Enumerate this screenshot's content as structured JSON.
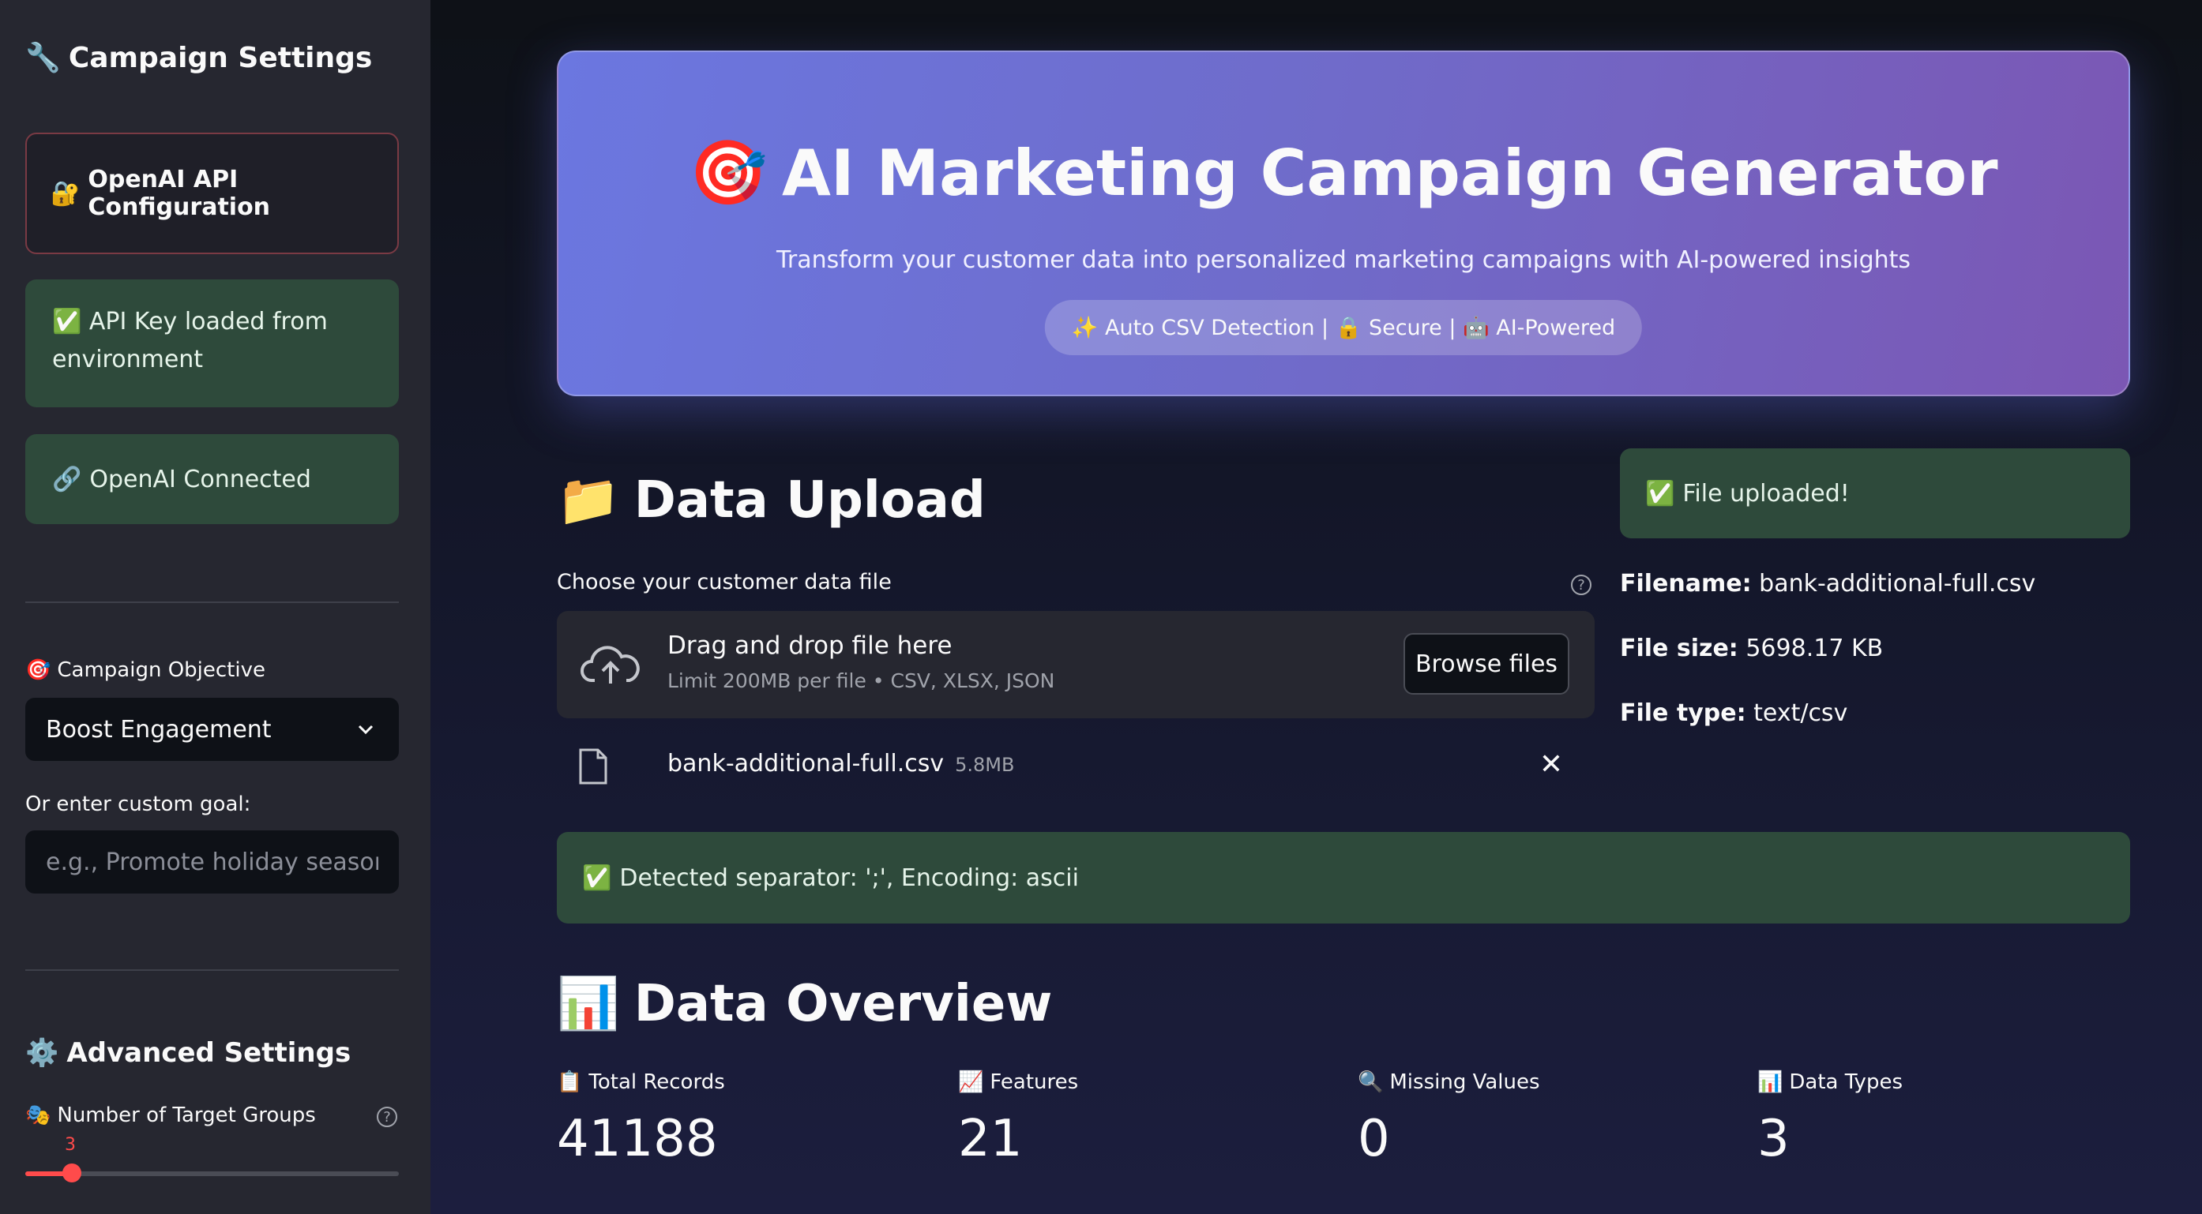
{
  "sidebar": {
    "title": "Campaign Settings",
    "api_config": "OpenAI API Configuration",
    "api_key_status": "API Key loaded from environment",
    "connection_status": "OpenAI Connected",
    "objective_label": "Campaign Objective",
    "objective_value": "Boost Engagement",
    "custom_goal_label": "Or enter custom goal:",
    "custom_goal_placeholder": "e.g., Promote holiday season offers",
    "advanced_title": "Advanced Settings",
    "target_groups_label": "Number of Target Groups",
    "target_groups_value": 3,
    "target_groups_min": 2,
    "target_groups_max": 10,
    "icons": {
      "title": "wrench-icon",
      "api_config": "lock-key-icon",
      "api_key_status": "check-icon",
      "connection_status": "link-icon",
      "objective": "target-icon",
      "advanced": "gear-icon",
      "target_groups": "mask-icon"
    }
  },
  "hero": {
    "title": "AI Marketing Campaign Generator",
    "subtitle": "Transform your customer data into personalized marketing campaigns with AI-powered insights",
    "badge": "✨ Auto CSV Detection | 🔒 Secure | 🤖 AI-Powered"
  },
  "upload": {
    "heading": "Data Upload",
    "label": "Choose your customer data file",
    "drop_title": "Drag and drop file here",
    "drop_limit": "Limit 200MB per file • CSV, XLSX, JSON",
    "browse_label": "Browse files",
    "file_name": "bank-additional-full.csv",
    "file_size": "5.8MB",
    "detected": "Detected separator: ';', Encoding: ascii"
  },
  "file_info": {
    "status": "File uploaded!",
    "filename_label": "Filename:",
    "filename_value": "bank-additional-full.csv",
    "size_label": "File size:",
    "size_value": "5698.17 KB",
    "type_label": "File type:",
    "type_value": "text/csv"
  },
  "overview": {
    "heading": "Data Overview",
    "metrics": [
      {
        "label": "Total Records",
        "value": "41188",
        "icon": "clipboard-icon"
      },
      {
        "label": "Features",
        "value": "21",
        "icon": "trend-chart-icon"
      },
      {
        "label": "Missing Values",
        "value": "0",
        "icon": "magnifier-icon"
      },
      {
        "label": "Data Types",
        "value": "3",
        "icon": "bar-chart-icon"
      }
    ]
  },
  "colors": {
    "accent": "#ff4b4b",
    "success_bg": "#2e4a3b",
    "hero_start": "#6b77e0",
    "hero_end": "#7b57b4"
  }
}
